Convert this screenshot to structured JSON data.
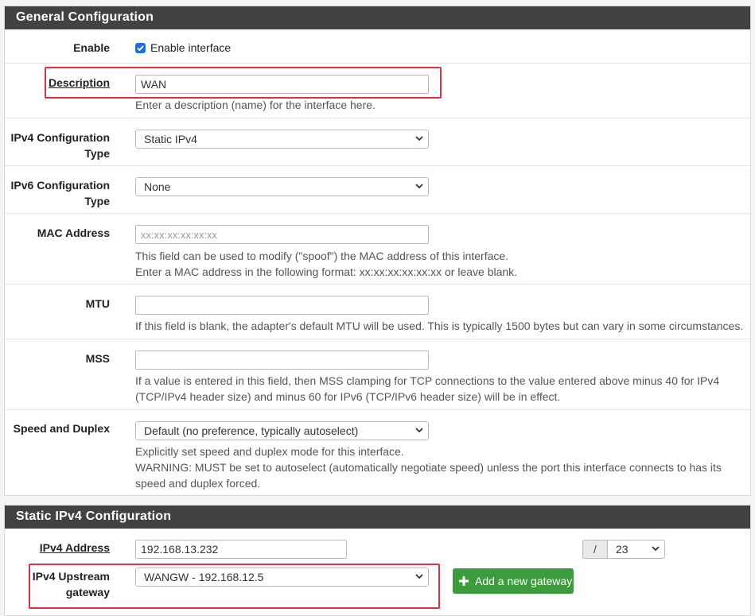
{
  "general": {
    "heading": "General Configuration",
    "enable": {
      "label": "Enable",
      "checkbox_label": "Enable interface",
      "checked": true
    },
    "description": {
      "label": "Description",
      "value": "WAN",
      "help": "Enter a description (name) for the interface here."
    },
    "ipv4_type": {
      "label_line1": "IPv4 Configuration",
      "label_line2": "Type",
      "value": "Static IPv4"
    },
    "ipv6_type": {
      "label_line1": "IPv6 Configuration",
      "label_line2": "Type",
      "value": "None"
    },
    "mac": {
      "label": "MAC Address",
      "placeholder": "xx:xx:xx:xx:xx:xx",
      "help_line1": "This field can be used to modify (\"spoof\") the MAC address of this interface.",
      "help_line2": "Enter a MAC address in the following format: xx:xx:xx:xx:xx:xx or leave blank."
    },
    "mtu": {
      "label": "MTU",
      "value": "",
      "help": "If this field is blank, the adapter's default MTU will be used. This is typically 1500 bytes but can vary in some circumstances."
    },
    "mss": {
      "label": "MSS",
      "value": "",
      "help_line1": "If a value is entered in this field, then MSS clamping for TCP connections to the value entered above minus 40 for IPv4",
      "help_line2": "(TCP/IPv4 header size) and minus 60 for IPv6 (TCP/IPv6 header size) will be in effect."
    },
    "speed": {
      "label": "Speed and Duplex",
      "value": "Default (no preference, typically autoselect)",
      "help_line1": "Explicitly set speed and duplex mode for this interface.",
      "help_line2": "WARNING: MUST be set to autoselect (automatically negotiate speed) unless the port this interface connects to has its",
      "help_line3": "speed and duplex forced."
    }
  },
  "static_ipv4": {
    "heading": "Static IPv4 Configuration",
    "address": {
      "label": "IPv4 Address",
      "value": "192.168.13.232",
      "slash": "/",
      "cidr": "23"
    },
    "gateway": {
      "label_line1": "IPv4 Upstream",
      "label_line2": "gateway",
      "value": "WANGW - 192.168.12.5",
      "add_button": "Add a new gateway"
    }
  },
  "colors": {
    "heading_bg": "#424242",
    "highlight_border": "#e0303f",
    "button_green": "#3c9b3c",
    "checkbox_blue": "#1e6fd9"
  },
  "icons": [
    "checkmark-icon",
    "chevron-down-icon",
    "plus-icon"
  ]
}
